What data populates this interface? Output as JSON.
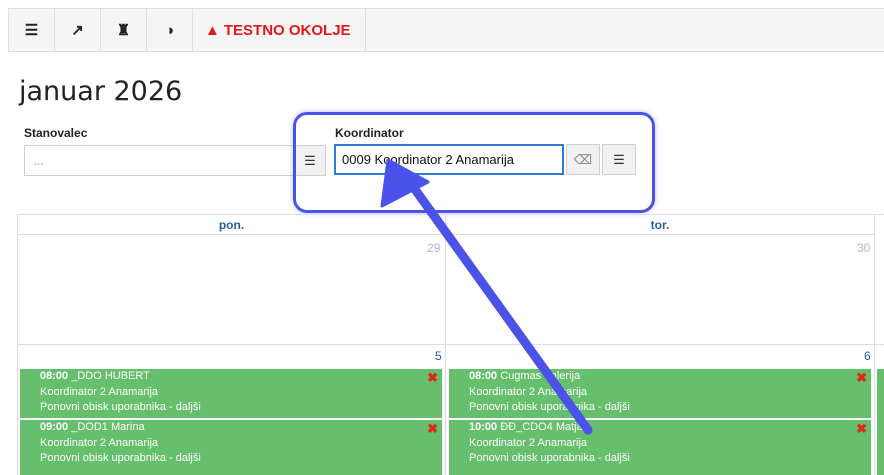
{
  "toolbar": {
    "buttons": [
      {
        "name": "menu-indent-icon",
        "glyph": "☰"
      },
      {
        "name": "external-link-icon",
        "glyph": "↗"
      },
      {
        "name": "user-lock-icon",
        "glyph": "♜"
      },
      {
        "name": "contrast-icon",
        "glyph": "◑"
      }
    ],
    "warning_glyph": "▲",
    "warning_label": "TESTNO OKOLJE"
  },
  "page": {
    "title": "januar 2026"
  },
  "filters": {
    "resident_label": "Stanovalec",
    "resident_placeholder": "...",
    "coordinator_label": "Koordinator",
    "coordinator_value": "0009 Koordinator 2 Anamarija",
    "list_glyph": "☰",
    "eraser_glyph": "⌫"
  },
  "calendar": {
    "days": [
      "pon.",
      "tor."
    ],
    "week1_dates": [
      "29",
      "30"
    ],
    "week2_dates": [
      "5",
      "6"
    ],
    "events_mon": [
      {
        "time": "08:00",
        "name": "_DDO HUBERT",
        "coord": "Koordinator 2 Anamarija",
        "type": "Ponovni obisk uporabnika - daljši"
      },
      {
        "time": "09:00",
        "name": "_DOD1 Marina",
        "coord": "Koordinator 2 Anamarija",
        "type": "Ponovni obisk uporabnika - daljši"
      }
    ],
    "events_tue": [
      {
        "time": "08:00",
        "name": "Cugmas Valerija",
        "coord": "Koordinator 2 Anamarija",
        "type": "Ponovni obisk uporabnika - daljši"
      },
      {
        "time": "10:00",
        "name": "ĐĐ_CDO4 Matjaž",
        "coord": "Koordinator 2 Anamarija",
        "type": "Ponovni obisk uporabnika - daljši"
      }
    ],
    "delete_glyph": "✖",
    "colors": {
      "event": "#66bf6c",
      "header_text": "#2a5f96",
      "delete": "#e0281a",
      "annotation": "#4a52e8"
    }
  }
}
